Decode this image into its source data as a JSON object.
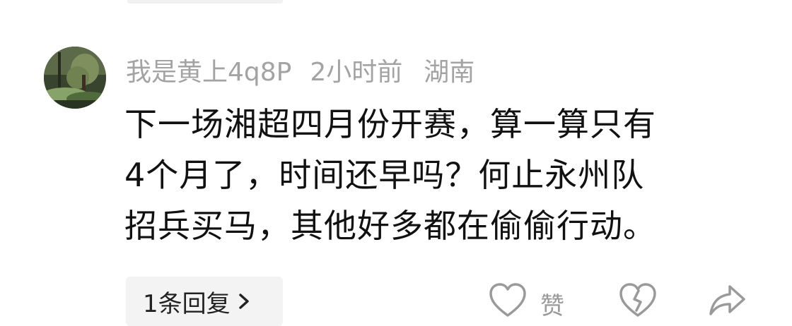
{
  "comment": {
    "username": "我是黄上4q8P",
    "time_ago": "2小时前",
    "location": "湖南",
    "text_lines": [
      "下一场湘超四月份开赛，算一算只有",
      "4个月了，时间还早吗？何止永州队",
      "招兵买马，其他好多都在偷偷行动。"
    ],
    "reply_label": "1条回复",
    "like_label": "赞",
    "icons": {
      "reply_chevron": "chevron-right-icon",
      "like": "heart-outline-icon",
      "dislike": "broken-heart-icon",
      "share": "share-arrow-icon"
    }
  },
  "colors": {
    "meta_text": "#a3a3a3",
    "body_text": "#111111",
    "reply_bg": "#f3f3f3",
    "icon_stroke": "#9a9a9a"
  }
}
